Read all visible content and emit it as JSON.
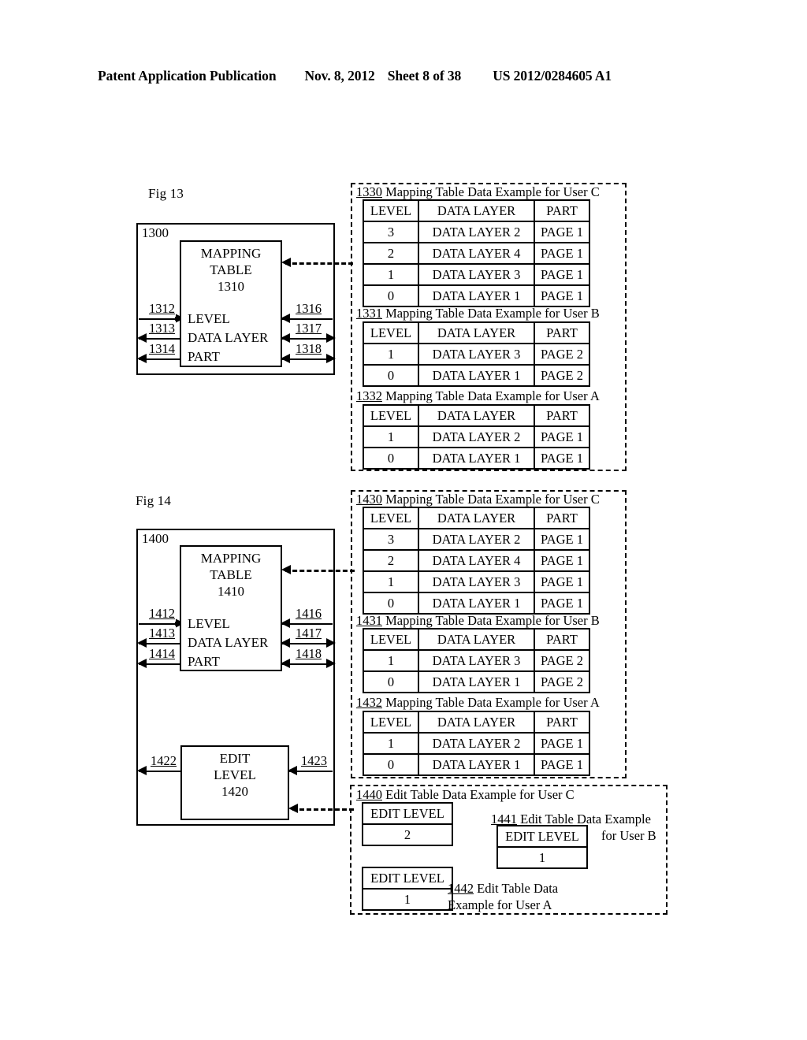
{
  "header": {
    "publication": "Patent Application Publication",
    "date": "Nov. 8, 2012",
    "sheet": "Sheet 8 of 38",
    "number": "US 2012/0284605 A1"
  },
  "fig13": {
    "label": "Fig 13",
    "outer_box_id": "1300",
    "mapping_block": {
      "line1": "MAPPING",
      "line2": "TABLE",
      "line3": "1310",
      "ports": [
        "LEVEL",
        "DATA LAYER",
        "PART"
      ],
      "left_refs": [
        "1312",
        "1313",
        "1314"
      ],
      "right_refs": [
        "1316",
        "1317",
        "1318"
      ]
    },
    "tables": [
      {
        "num": "1330",
        "caption": " Mapping Table Data Example for User C",
        "headers": [
          "LEVEL",
          "DATA LAYER",
          "PART"
        ],
        "rows": [
          [
            "3",
            "DATA LAYER 2",
            "PAGE 1"
          ],
          [
            "2",
            "DATA LAYER 4",
            "PAGE 1"
          ],
          [
            "1",
            "DATA LAYER 3",
            "PAGE 1"
          ],
          [
            "0",
            "DATA LAYER 1",
            "PAGE 1"
          ]
        ]
      },
      {
        "num": "1331",
        "caption": " Mapping Table Data Example for User B",
        "headers": [
          "LEVEL",
          "DATA LAYER",
          "PART"
        ],
        "rows": [
          [
            "1",
            "DATA LAYER 3",
            "PAGE 2"
          ],
          [
            "0",
            "DATA LAYER 1",
            "PAGE 2"
          ]
        ]
      },
      {
        "num": "1332",
        "caption": " Mapping Table Data Example for User A",
        "headers": [
          "LEVEL",
          "DATA LAYER",
          "PART"
        ],
        "rows": [
          [
            "1",
            "DATA LAYER 2",
            "PAGE 1"
          ],
          [
            "0",
            "DATA LAYER 1",
            "PAGE 1"
          ]
        ]
      }
    ]
  },
  "fig14": {
    "label": "Fig 14",
    "outer_box_id": "1400",
    "mapping_block": {
      "line1": "MAPPING",
      "line2": "TABLE",
      "line3": "1410",
      "ports": [
        "LEVEL",
        "DATA LAYER",
        "PART"
      ],
      "left_refs": [
        "1412",
        "1413",
        "1414"
      ],
      "right_refs": [
        "1416",
        "1417",
        "1418"
      ]
    },
    "edit_block": {
      "line1": "EDIT",
      "line2": "LEVEL",
      "line3": "1420",
      "left_ref": "1422",
      "right_ref": "1423"
    },
    "tables": [
      {
        "num": "1430",
        "caption": " Mapping Table Data Example for User C",
        "headers": [
          "LEVEL",
          "DATA LAYER",
          "PART"
        ],
        "rows": [
          [
            "3",
            "DATA LAYER 2",
            "PAGE 1"
          ],
          [
            "2",
            "DATA LAYER 4",
            "PAGE 1"
          ],
          [
            "1",
            "DATA LAYER 3",
            "PAGE 1"
          ],
          [
            "0",
            "DATA LAYER 1",
            "PAGE 1"
          ]
        ]
      },
      {
        "num": "1431",
        "caption": " Mapping Table Data Example for User B",
        "headers": [
          "LEVEL",
          "DATA LAYER",
          "PART"
        ],
        "rows": [
          [
            "1",
            "DATA LAYER 3",
            "PAGE 2"
          ],
          [
            "0",
            "DATA LAYER 1",
            "PAGE 2"
          ]
        ]
      },
      {
        "num": "1432",
        "caption": " Mapping Table Data Example for User A",
        "headers": [
          "LEVEL",
          "DATA LAYER",
          "PART"
        ],
        "rows": [
          [
            "1",
            "DATA LAYER 2",
            "PAGE 1"
          ],
          [
            "0",
            "DATA LAYER 1",
            "PAGE 1"
          ]
        ]
      }
    ],
    "edit_tables": [
      {
        "num": "1440",
        "caption": " Edit Table Data Example for User C",
        "header": "EDIT LEVEL",
        "value": "2"
      },
      {
        "num": "1441",
        "caption_line1": " Edit Table Data Example",
        "caption_line2": "for User B",
        "header": "EDIT LEVEL",
        "value": "1"
      },
      {
        "num": "1442",
        "caption_line1": " Edit Table Data",
        "caption_line2": "Example for User A",
        "header": "EDIT LEVEL",
        "value": "1"
      }
    ]
  }
}
